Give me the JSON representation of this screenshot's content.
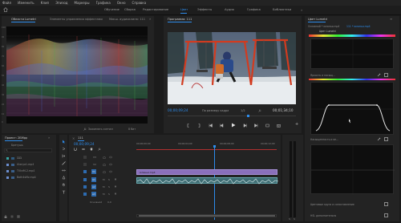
{
  "menu": [
    "Файл",
    "Изменить",
    "Клип",
    "Эпизод",
    "Маркеры",
    "Графика",
    "Окно",
    "Справка"
  ],
  "workspaces": [
    "Обучение",
    "Сборка",
    "Редактирование",
    "Цвет",
    "Эффекты",
    "Аудио",
    "Графика",
    "Библиотеки"
  ],
  "active_workspace": "Цвет",
  "scopes_panel": {
    "tab_active": "Области Lumetri",
    "tab_2": "Элементы управления эффектами",
    "tab_3": "Микш. аудиоклипа: 111",
    "scale_labels": [
      "100",
      "90",
      "80",
      "70",
      "60",
      "50",
      "40",
      "30",
      "20",
      "10",
      "0"
    ],
    "bottom_label": "Зажимать сигнал"
  },
  "program": {
    "title": "Программа: 111",
    "timecode_current": "00;00;09;24",
    "fit_label": "По размеру кадра",
    "quality": "1/2",
    "timecode_total": "00;01;34;10"
  },
  "lumetri": {
    "title": "Цвет Lumetri",
    "source_label": "Основной * юланья.mp4",
    "seq_label": "111 * юланья.mp4",
    "fx_name": "Цвет Lumetri",
    "section_hue": "Яркость и насыщ...",
    "section_lum": "Насыщенность и ян...",
    "bottom_1": "Цветовые круги и сопоставление",
    "bottom_2": "HSL дополнительно"
  },
  "project": {
    "title": "Проект: 2БMpp",
    "subtitle": "Бретушь",
    "items": [
      "111",
      "Ulanya1.mp4",
      "TVIrzM-2.mp4",
      "Bath4sMz.mp4"
    ],
    "footer_count": "4 из 6"
  },
  "timeline": {
    "tab": "111",
    "timecode": "00;00;09;24",
    "ruler_labels": [
      "00;00;00;00",
      "00;00;04;00",
      "00;00;08;00",
      "00;00;12;00"
    ],
    "tracks_video": [
      "V3",
      "V2",
      "V1"
    ],
    "tracks_audio": [
      "A1",
      "A2",
      "A3"
    ],
    "master_label": "Основной",
    "master_value": "0,0",
    "clip_label": "юланья.mp4"
  },
  "chart_data": null
}
